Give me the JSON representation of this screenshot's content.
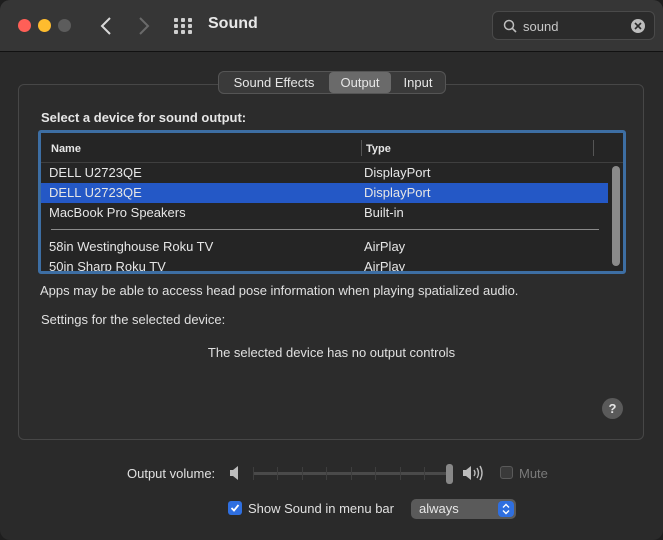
{
  "window": {
    "title": "Sound"
  },
  "search": {
    "value": "sound"
  },
  "tabs": [
    {
      "label": "Sound Effects",
      "active": false
    },
    {
      "label": "Output",
      "active": true
    },
    {
      "label": "Input",
      "active": false
    }
  ],
  "output": {
    "section_label": "Select a device for sound output:",
    "columns": {
      "name": "Name",
      "type": "Type"
    },
    "devices": [
      {
        "name": "DELL U2723QE",
        "type": "DisplayPort",
        "selected": false
      },
      {
        "name": "DELL U2723QE",
        "type": "DisplayPort",
        "selected": true
      },
      {
        "name": "MacBook Pro Speakers",
        "type": "Built-in",
        "selected": false
      },
      {
        "name": "58in Westinghouse Roku TV",
        "type": "AirPlay",
        "selected": false
      },
      {
        "name": "50in Sharp Roku TV",
        "type": "AirPlay",
        "selected": false
      }
    ],
    "note": "Apps may be able to access head pose information when playing spatialized audio.",
    "settings_label": "Settings for the selected device:",
    "no_controls": "The selected device has no output controls",
    "help": "?"
  },
  "volume": {
    "label": "Output volume:",
    "level": 1.0,
    "mute_label": "Mute",
    "muted": false
  },
  "menubar": {
    "label": "Show Sound in menu bar",
    "checked": true,
    "select_value": "always"
  },
  "colors": {
    "accent": "#2f6fe0",
    "selection": "#2458c6",
    "focus_ring": "#3d6ea3"
  }
}
